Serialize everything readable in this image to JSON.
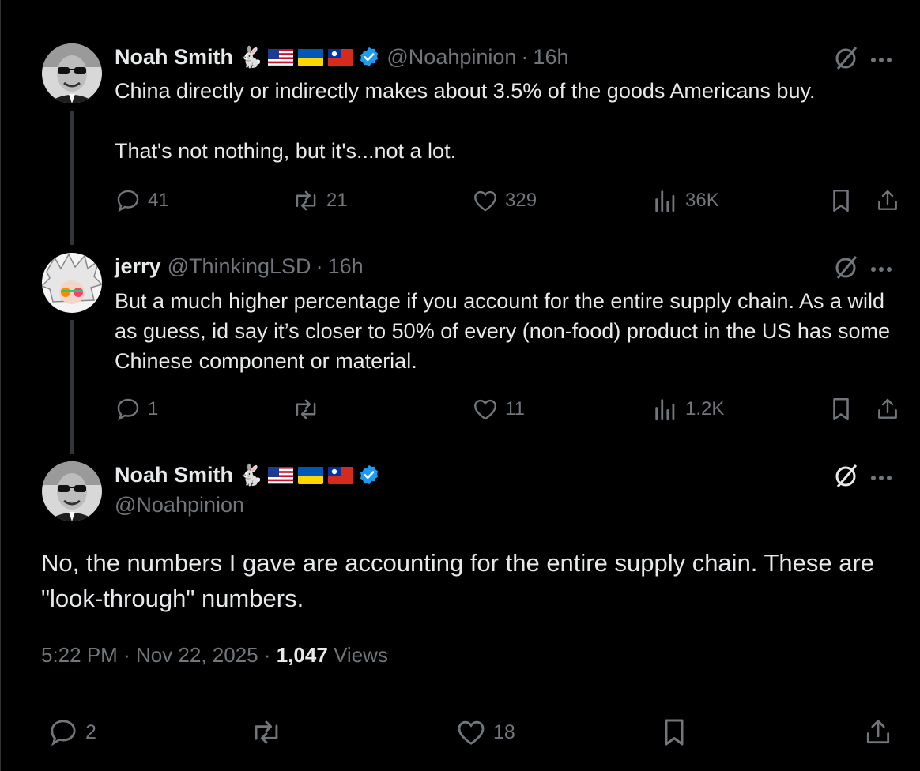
{
  "tweets": [
    {
      "name": "Noah Smith",
      "emoji": "🐇",
      "handle": "@Noahpinion",
      "time": "16h",
      "text": "China directly or indirectly makes about 3.5% of the goods Americans buy.\n\nThat's not nothing, but it's...not a lot.",
      "replies": "41",
      "reposts": "21",
      "likes": "329",
      "views": "36K"
    },
    {
      "name": "jerry",
      "handle": "@ThinkingLSD",
      "time": "16h",
      "text": "But a much higher percentage if you account for the entire supply chain. As a wild as guess, id say it’s closer to 50% of every (non-food) product in the US has some Chinese component or material.",
      "replies": "1",
      "reposts": "",
      "likes": "11",
      "views": "1.2K"
    }
  ],
  "main_tweet": {
    "name": "Noah Smith",
    "emoji": "🐇",
    "handle": "@Noahpinion",
    "text": "No, the numbers I gave are accounting for the entire supply chain. These are \"look-through\" numbers.",
    "time": "5:22 PM",
    "date": "Nov 22, 2025",
    "views_count": "1,047",
    "views_label": "Views",
    "replies": "2",
    "reposts": "",
    "likes": "18"
  },
  "colors": {
    "background": "#000000",
    "text": "#e7e9ea",
    "muted": "#71767b",
    "verified": "#1d9bf0",
    "divider": "#2f3336"
  },
  "icons": [
    "rabbit-emoji",
    "us-flag-icon",
    "ukraine-flag-icon",
    "taiwan-flag-icon",
    "verified-badge-icon",
    "grok-icon",
    "more-icon",
    "reply-icon",
    "repost-icon",
    "like-icon",
    "views-icon",
    "bookmark-icon",
    "share-icon"
  ]
}
